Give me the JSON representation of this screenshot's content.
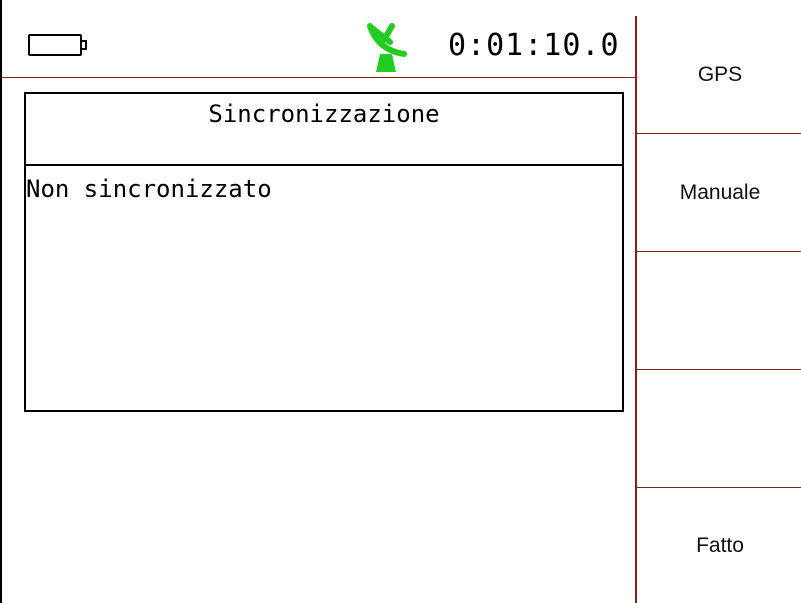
{
  "status": {
    "battery_icon": "battery-icon",
    "gps_icon": "satellite-dish-icon",
    "gps_color": "#22cc22",
    "timer": "0:01:10.0"
  },
  "dialog": {
    "title": "Sincronizzazione",
    "message": "Non sincronizzato"
  },
  "softkeys": [
    {
      "label": "GPS"
    },
    {
      "label": "Manuale"
    },
    {
      "label": ""
    },
    {
      "label": ""
    },
    {
      "label": "Fatto"
    }
  ],
  "colors": {
    "divider": "#8b1a1a",
    "background": "#ffffff"
  }
}
